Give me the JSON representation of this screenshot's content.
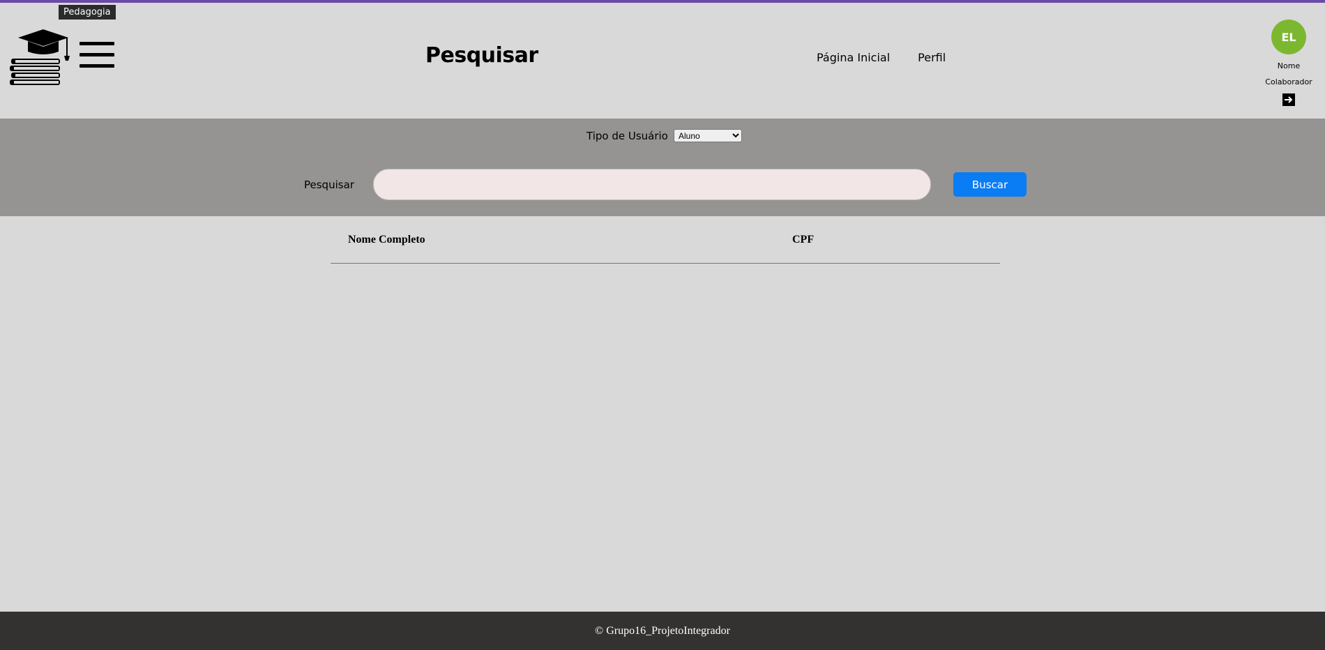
{
  "tooltip": "Pedagogia",
  "header": {
    "title": "Pesquisar",
    "nav": [
      "Página Inicial",
      "Perfil"
    ]
  },
  "user": {
    "initials": "EL",
    "name": "Nome",
    "role": "Colaborador",
    "avatar_color": "#7cb82f"
  },
  "filters": {
    "type_label": "Tipo de Usuário",
    "type_selected": "Aluno",
    "search_label": "Pesquisar",
    "search_value": "",
    "search_button": "Buscar"
  },
  "table": {
    "columns": [
      "Nome Completo",
      "CPF"
    ],
    "rows": []
  },
  "footer": {
    "text": "© Grupo16_ProjetoIntegrador"
  },
  "colors": {
    "accent_stripe": "#6b4aa8",
    "button": "#0a7cf4",
    "filter_bar": "#959493",
    "footer": "#333230"
  },
  "icons": [
    "graduation-books-logo-icon",
    "hamburger-menu-icon",
    "logout-icon"
  ]
}
